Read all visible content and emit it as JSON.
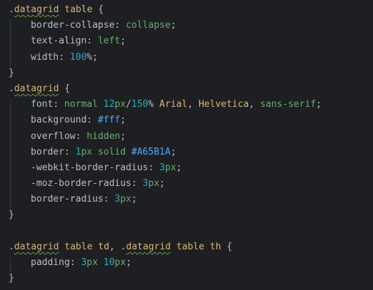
{
  "lines": [
    {
      "segments": [
        {
          "t": ".",
          "c": "sel"
        },
        {
          "t": "datagrid",
          "c": "cls squig"
        },
        {
          "t": " table ",
          "c": "sel"
        },
        {
          "t": "{",
          "c": "punc"
        }
      ]
    },
    {
      "indent": true,
      "segments": [
        {
          "t": "border-collapse",
          "c": "prop"
        },
        {
          "t": ": ",
          "c": "punc"
        },
        {
          "t": "collapse",
          "c": "kw"
        },
        {
          "t": ";",
          "c": "punc"
        }
      ]
    },
    {
      "indent": true,
      "segments": [
        {
          "t": "text-align",
          "c": "prop"
        },
        {
          "t": ": ",
          "c": "punc"
        },
        {
          "t": "left",
          "c": "kw"
        },
        {
          "t": ";",
          "c": "punc"
        }
      ]
    },
    {
      "indent": true,
      "segments": [
        {
          "t": "width",
          "c": "prop"
        },
        {
          "t": ": ",
          "c": "punc"
        },
        {
          "t": "100",
          "c": "num"
        },
        {
          "t": "%",
          "c": "unit"
        },
        {
          "t": ";",
          "c": "punc"
        }
      ]
    },
    {
      "segments": [
        {
          "t": "}",
          "c": "punc"
        }
      ]
    },
    {
      "segments": [
        {
          "t": ".",
          "c": "sel"
        },
        {
          "t": "datagrid",
          "c": "cls squig"
        },
        {
          "t": " ",
          "c": "sel"
        },
        {
          "t": "{",
          "c": "punc"
        }
      ]
    },
    {
      "indent": true,
      "segments": [
        {
          "t": "font",
          "c": "prop"
        },
        {
          "t": ": ",
          "c": "punc"
        },
        {
          "t": "normal ",
          "c": "kw"
        },
        {
          "t": "12",
          "c": "num"
        },
        {
          "t": "px",
          "c": "kw"
        },
        {
          "t": "/",
          "c": "punc"
        },
        {
          "t": "150",
          "c": "num"
        },
        {
          "t": "% ",
          "c": "unit"
        },
        {
          "t": "Arial",
          "c": "font"
        },
        {
          "t": ", ",
          "c": "punc"
        },
        {
          "t": "Helvetica",
          "c": "font"
        },
        {
          "t": ", ",
          "c": "punc"
        },
        {
          "t": "sans-serif",
          "c": "kw"
        },
        {
          "t": ";",
          "c": "punc"
        }
      ]
    },
    {
      "indent": true,
      "segments": [
        {
          "t": "background",
          "c": "prop"
        },
        {
          "t": ": ",
          "c": "punc"
        },
        {
          "t": "#fff",
          "c": "hex"
        },
        {
          "t": ";",
          "c": "punc"
        }
      ]
    },
    {
      "indent": true,
      "segments": [
        {
          "t": "overflow",
          "c": "prop"
        },
        {
          "t": ": ",
          "c": "punc"
        },
        {
          "t": "hidden",
          "c": "kw"
        },
        {
          "t": ";",
          "c": "punc"
        }
      ]
    },
    {
      "indent": true,
      "segments": [
        {
          "t": "border",
          "c": "prop"
        },
        {
          "t": ": ",
          "c": "punc"
        },
        {
          "t": "1",
          "c": "num"
        },
        {
          "t": "px ",
          "c": "kw"
        },
        {
          "t": "solid ",
          "c": "kw"
        },
        {
          "t": "#A65B1A",
          "c": "hex"
        },
        {
          "t": ";",
          "c": "punc"
        }
      ]
    },
    {
      "indent": true,
      "segments": [
        {
          "t": "-webkit-border-radius",
          "c": "prop"
        },
        {
          "t": ": ",
          "c": "punc"
        },
        {
          "t": "3",
          "c": "num"
        },
        {
          "t": "px",
          "c": "kw"
        },
        {
          "t": ";",
          "c": "punc"
        }
      ]
    },
    {
      "indent": true,
      "segments": [
        {
          "t": "-moz-border-radius",
          "c": "prop"
        },
        {
          "t": ": ",
          "c": "punc"
        },
        {
          "t": "3",
          "c": "num"
        },
        {
          "t": "px",
          "c": "kw"
        },
        {
          "t": ";",
          "c": "punc"
        }
      ]
    },
    {
      "indent": true,
      "segments": [
        {
          "t": "border-radius",
          "c": "prop"
        },
        {
          "t": ": ",
          "c": "punc"
        },
        {
          "t": "3",
          "c": "num"
        },
        {
          "t": "px",
          "c": "kw"
        },
        {
          "t": ";",
          "c": "punc"
        }
      ]
    },
    {
      "segments": [
        {
          "t": "}",
          "c": "punc"
        }
      ]
    },
    {
      "segments": []
    },
    {
      "segments": [
        {
          "t": ".",
          "c": "sel"
        },
        {
          "t": "datagrid",
          "c": "cls squig"
        },
        {
          "t": " table td, .",
          "c": "sel"
        },
        {
          "t": "datagrid",
          "c": "cls squig"
        },
        {
          "t": " table th ",
          "c": "sel"
        },
        {
          "t": "{",
          "c": "punc"
        }
      ]
    },
    {
      "indent": true,
      "segments": [
        {
          "t": "padding",
          "c": "prop"
        },
        {
          "t": ": ",
          "c": "punc"
        },
        {
          "t": "3",
          "c": "num"
        },
        {
          "t": "px ",
          "c": "kw"
        },
        {
          "t": "10",
          "c": "num"
        },
        {
          "t": "px",
          "c": "kw"
        },
        {
          "t": ";",
          "c": "punc"
        }
      ]
    },
    {
      "segments": [
        {
          "t": "}",
          "c": "punc"
        }
      ]
    }
  ]
}
